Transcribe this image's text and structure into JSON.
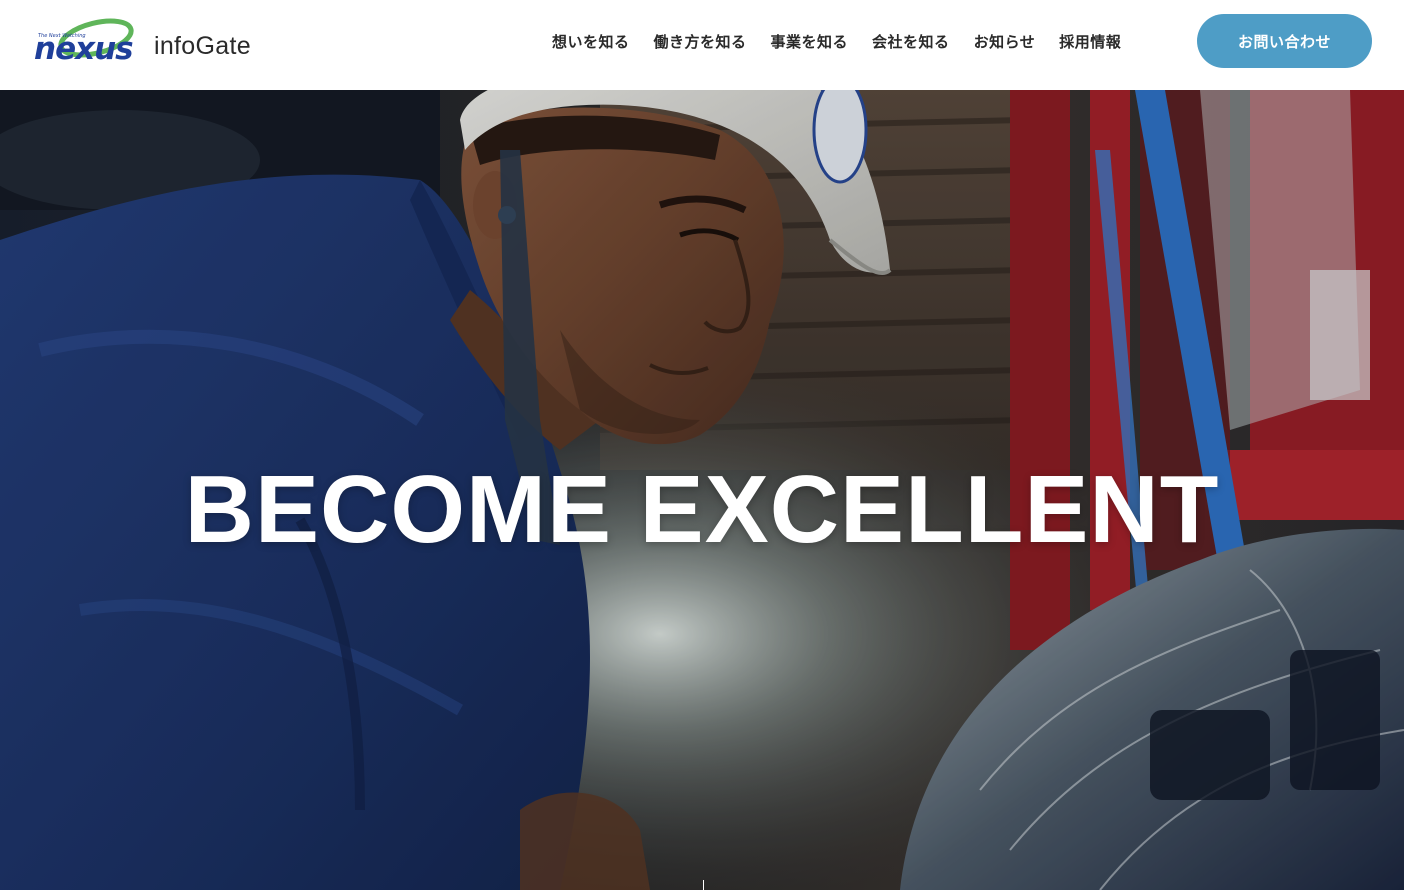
{
  "header": {
    "logo": {
      "brand": "nexus",
      "tagline": "The Next Watching",
      "product": "infoGate"
    },
    "nav": [
      {
        "label": "想いを知る"
      },
      {
        "label": "働き方を知る"
      },
      {
        "label": "事業を知る"
      },
      {
        "label": "会社を知る"
      },
      {
        "label": "お知らせ"
      },
      {
        "label": "採用情報"
      }
    ],
    "contact_label": "お問い合わせ"
  },
  "hero": {
    "title": "BECOME EXCELLENT",
    "photo_icon": "worker-photo"
  },
  "colors": {
    "accent": "#4e9dc6",
    "brand_blue": "#1f3f9a",
    "nav_text": "#2a2a2a",
    "hero_text": "#ffffff"
  }
}
